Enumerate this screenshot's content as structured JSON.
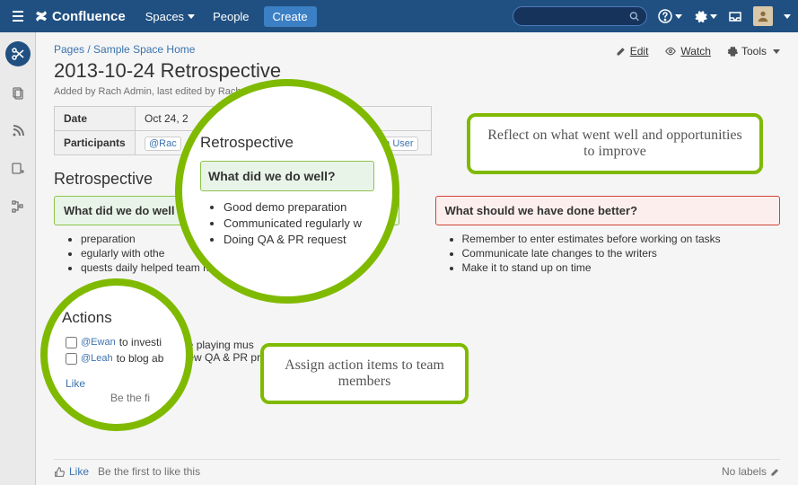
{
  "topnav": {
    "product": "Confluence",
    "spaces": "Spaces",
    "people": "People",
    "create": "Create"
  },
  "breadcrumb": {
    "pages": "Pages",
    "space": "Sample Space Home"
  },
  "page": {
    "title": "2013-10-24 Retrospective",
    "meta": "Added by Rach Admin, last edited by Rach"
  },
  "actions": {
    "edit": "Edit",
    "watch": "Watch",
    "tools": "Tools"
  },
  "meta_table": {
    "date_label": "Date",
    "date_value": "Oct 24, 2",
    "participants_label": "Participants",
    "p1": "@Rac",
    "p2": "Ewan User"
  },
  "retro": {
    "heading": "Retrospective",
    "well_header": "What did we do well",
    "well_items": [
      "preparation",
      "egularly with othe",
      "quests daily helped team move faster"
    ],
    "better_header": "What should we have done better?",
    "better_items": [
      "Remember to enter estimates before working on tasks",
      "Communicate late changes to the writers",
      "Make it to stand up on time"
    ]
  },
  "actions_section": {
    "heading": "Actions",
    "a1_user": "Ewan",
    "a1_text": "to investi",
    "a1_full": "stigate playing mus",
    "a2_user": "Leah",
    "a2_text": "to blog ab",
    "a2_full": "log about new QA & PR process to share with other teams"
  },
  "like_bar": {
    "like": "Like",
    "first": "Be the first to like this",
    "also_like": "Like",
    "also_first": "Be the fi",
    "no_labels": "No labels"
  },
  "callout_big": {
    "title": "Retrospective",
    "header": "What did we do well?",
    "items": [
      "Good demo preparation",
      "Communicated regularly w",
      "Doing QA & PR request"
    ]
  },
  "callout_small": {
    "title": "Actions",
    "u1": "Ewan",
    "t1": "to investi",
    "u2": "Leah",
    "t2": "to blog ab",
    "link": "Like"
  },
  "callout_box1": "Reflect on what went well and opportunities to improve",
  "callout_box2": "Assign action items to team members"
}
